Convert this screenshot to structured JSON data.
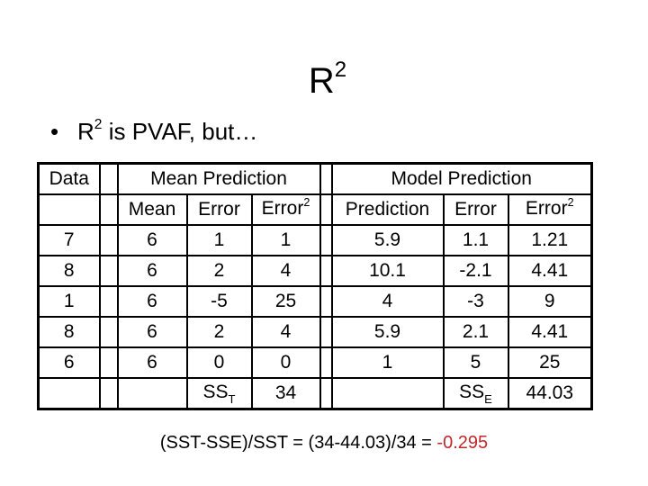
{
  "title": {
    "base": "R",
    "superscript": "2"
  },
  "bullet": {
    "marker": "•",
    "lead": "R",
    "superscript": "2",
    "rest": " is PVAF, but…"
  },
  "table": {
    "header_row_1": {
      "data": "Data",
      "mean_group": "Mean Prediction",
      "model_group": "Model Prediction"
    },
    "header_row_2": {
      "mean": "Mean",
      "mean_error": "Error",
      "mean_error_sq_base": "Error",
      "mean_error_sq_sup": "2",
      "model_prediction": "Prediction",
      "model_error": "Error",
      "model_error_sq_base": "Error",
      "model_error_sq_sup": "2"
    },
    "rows": [
      {
        "data": "7",
        "mean": "6",
        "mean_error": "1",
        "mean_error_sq": "1",
        "prediction": "5.9",
        "model_error": "1.1",
        "model_error_sq": "1.21"
      },
      {
        "data": "8",
        "mean": "6",
        "mean_error": "2",
        "mean_error_sq": "4",
        "prediction": "10.1",
        "model_error": "-2.1",
        "model_error_sq": "4.41"
      },
      {
        "data": "1",
        "mean": "6",
        "mean_error": "-5",
        "mean_error_sq": "25",
        "prediction": "4",
        "model_error": "-3",
        "model_error_sq": "9"
      },
      {
        "data": "8",
        "mean": "6",
        "mean_error": "2",
        "mean_error_sq": "4",
        "prediction": "5.9",
        "model_error": "2.1",
        "model_error_sq": "4.41"
      },
      {
        "data": "6",
        "mean": "6",
        "mean_error": "0",
        "mean_error_sq": "0",
        "prediction": "1",
        "model_error": "5",
        "model_error_sq": "25"
      }
    ],
    "totals": {
      "sst_label_base": "SS",
      "sst_label_sub": "T",
      "sst_value": "34",
      "sse_label_base": "SS",
      "sse_label_sub": "E",
      "sse_value": "44.03"
    }
  },
  "formula": {
    "expression": "(SST-SSE)/SST = (34-44.03)/34 = ",
    "result": "-0.295",
    "result_color": "#c0282c"
  }
}
